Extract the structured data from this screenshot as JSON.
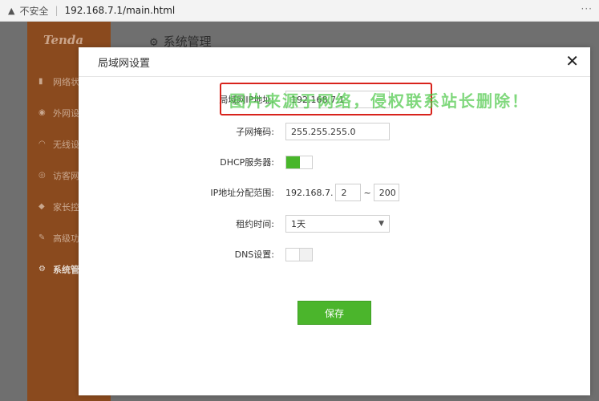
{
  "browser": {
    "security_label": "不安全",
    "url": "192.168.7.1/main.html"
  },
  "app": {
    "logo": "Tenda",
    "title": "系统管理",
    "nav": [
      {
        "label": "网络状"
      },
      {
        "label": "外网设"
      },
      {
        "label": "无线设"
      },
      {
        "label": "访客网"
      },
      {
        "label": "家长控"
      },
      {
        "label": "高级功"
      },
      {
        "label": "系统管"
      }
    ]
  },
  "modal": {
    "title": "局域网设置",
    "fields": {
      "lan_ip": {
        "label": "局域网IP地址:",
        "value": "192.168.7.1"
      },
      "subnet": {
        "label": "子网掩码:",
        "value": "255.255.255.0"
      },
      "dhcp": {
        "label": "DHCP服务器:",
        "enabled": true
      },
      "ip_range": {
        "label": "IP地址分配范围:",
        "prefix": "192.168.7.",
        "start": "2",
        "separator": "~",
        "end": "200"
      },
      "lease": {
        "label": "租约时间:",
        "selected": "1天"
      },
      "dns": {
        "label": "DNS设置:",
        "enabled": false
      }
    },
    "save_label": "保存"
  },
  "watermark": "图片来源于网络，侵权联系站长删除！",
  "colors": {
    "accent_green": "#4bb52c",
    "sidebar_orange": "#8a4a1e",
    "highlight_red": "#d8231c"
  }
}
